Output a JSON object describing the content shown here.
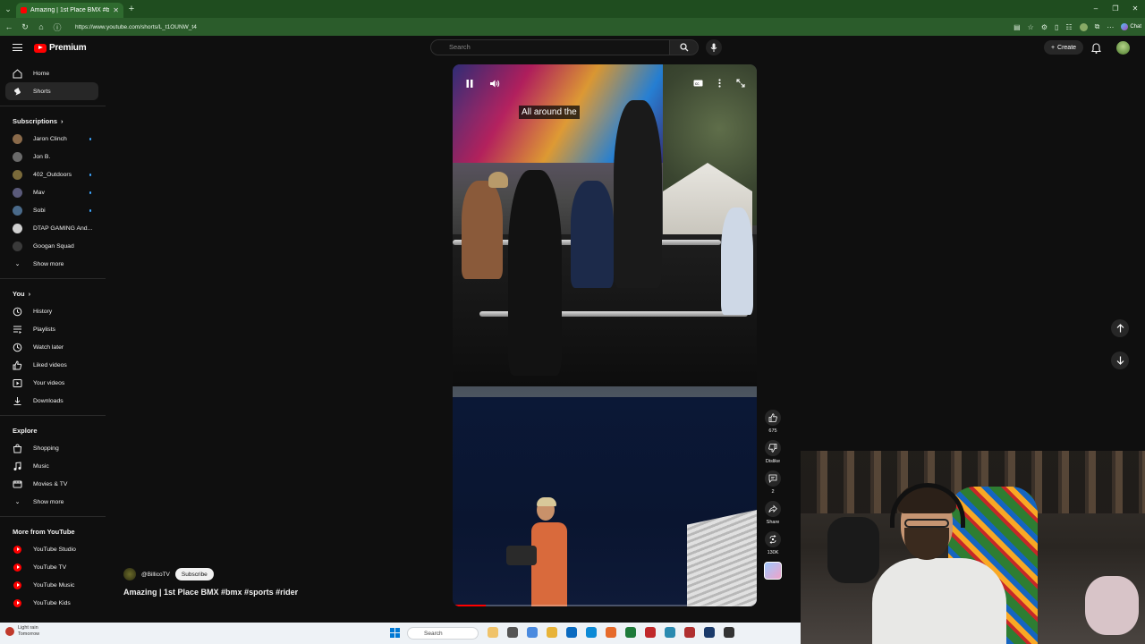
{
  "browser": {
    "tab_title": "Amazing | 1st Place BMX #bm",
    "url": "https://www.youtube.com/shorts/L_t1OUNW_t4",
    "chat_label": "Chat"
  },
  "header": {
    "logo_text": "Premium",
    "search_placeholder": "Search",
    "create_label": "Create"
  },
  "sidebar": {
    "main": [
      {
        "label": "Home",
        "icon": "home-icon"
      },
      {
        "label": "Shorts",
        "icon": "shorts-icon",
        "active": true
      }
    ],
    "subscriptions_title": "Subscriptions",
    "subscriptions": [
      {
        "label": "Jaron Clinch",
        "color": "#8a6a4a",
        "dot": true
      },
      {
        "label": "Jon B.",
        "color": "#6a6a6a",
        "dot": false
      },
      {
        "label": "402_Outdoors",
        "color": "#7a6a3a",
        "dot": true
      },
      {
        "label": "Mav",
        "color": "#5a5a7a",
        "dot": true
      },
      {
        "label": "Sobi",
        "color": "#4a6a8a",
        "dot": true
      },
      {
        "label": "DTAP GAMING And...",
        "color": "#d0d0d0",
        "dot": false
      },
      {
        "label": "Googan Squad",
        "color": "#3a3a3a",
        "dot": false
      }
    ],
    "show_more": "Show more",
    "you_title": "You",
    "you": [
      {
        "label": "History",
        "icon": "history-icon"
      },
      {
        "label": "Playlists",
        "icon": "playlists-icon"
      },
      {
        "label": "Watch later",
        "icon": "clock-icon"
      },
      {
        "label": "Liked videos",
        "icon": "thumbs-up-icon"
      },
      {
        "label": "Your videos",
        "icon": "play-square-icon"
      },
      {
        "label": "Downloads",
        "icon": "download-icon"
      }
    ],
    "explore_title": "Explore",
    "explore": [
      {
        "label": "Shopping",
        "icon": "shopping-bag-icon"
      },
      {
        "label": "Music",
        "icon": "music-note-icon"
      },
      {
        "label": "Movies & TV",
        "icon": "film-icon"
      }
    ],
    "explore_show_more": "Show more",
    "more_title": "More from YouTube",
    "more": [
      {
        "label": "YouTube Studio"
      },
      {
        "label": "YouTube TV"
      },
      {
        "label": "YouTube Music"
      },
      {
        "label": "YouTube Kids"
      }
    ]
  },
  "video": {
    "caption": "All around the",
    "progress": 0.11
  },
  "actions": {
    "likes": "675",
    "dislike_label": "Dislike",
    "comments": "2",
    "share_label": "Share",
    "remix_count": "130K"
  },
  "short": {
    "channel": "@BillicoTV",
    "subscribe_label": "Subscribe",
    "title": "Amazing | 1st Place BMX #bmx #sports #rider"
  },
  "taskbar": {
    "weather_title": "Light rain",
    "weather_sub": "Tomorrow",
    "search_label": "Search"
  },
  "colors": {
    "accent": "#ff0000",
    "background": "#0f0f0f"
  }
}
